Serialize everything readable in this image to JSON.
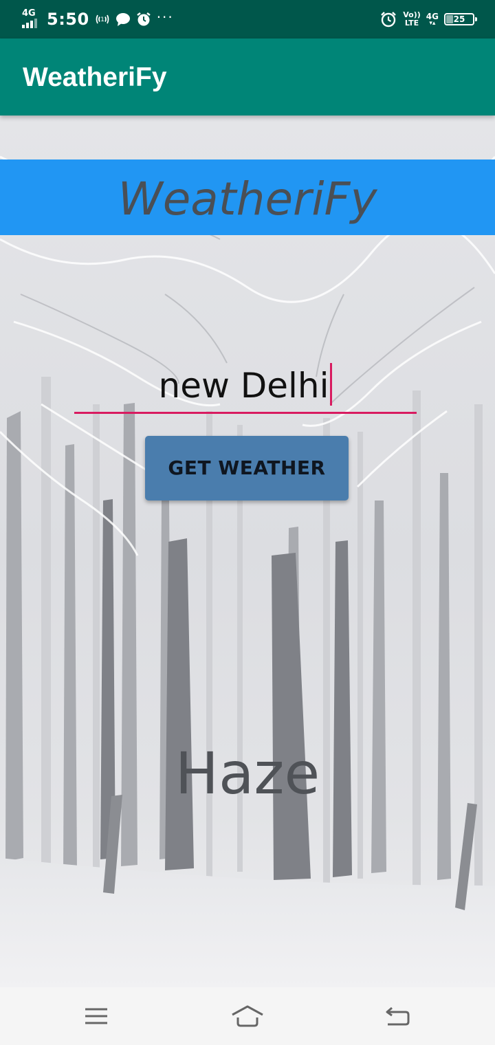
{
  "status_bar": {
    "network": "4G",
    "time": "5:50",
    "volte_top": "Vo))",
    "volte_bottom": "LTE",
    "data_network": "4G",
    "battery": "25",
    "icons": [
      "hotspot-icon",
      "chat-icon",
      "alarm-icon",
      "more-icon",
      "alarm-clock-icon",
      "battery-icon"
    ]
  },
  "app_bar": {
    "title": "WeatheriFy"
  },
  "banner": {
    "title": "WeatheriFy"
  },
  "city_input": {
    "value": "new Delhi"
  },
  "get_weather_button": {
    "label": "GET WEATHER"
  },
  "weather_result": {
    "text": "Haze"
  },
  "nav_bar": {
    "icons": [
      "menu-icon",
      "home-icon",
      "back-icon"
    ]
  },
  "colors": {
    "status_bar": "#00574b",
    "app_bar": "#008577",
    "banner": "#2196f3",
    "accent": "#d81b60",
    "button": "#4a7dad"
  }
}
